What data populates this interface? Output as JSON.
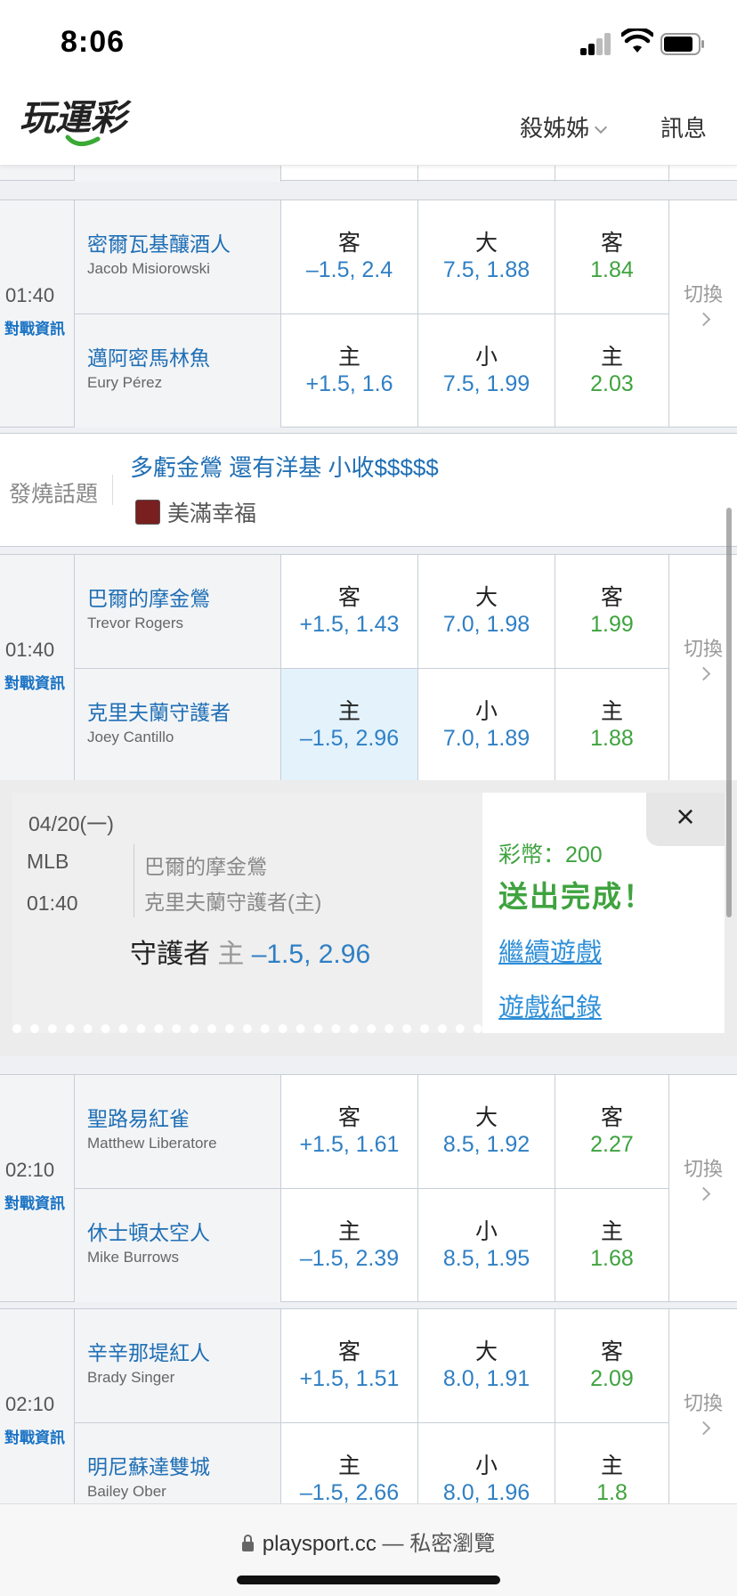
{
  "status": {
    "time": "8:06"
  },
  "header": {
    "logo_text": "玩運彩",
    "user": "殺姊姊",
    "messages": "訊息"
  },
  "common": {
    "info_link": "對戰資訊",
    "switch_label": "切換"
  },
  "games": [
    {
      "time": "01:40",
      "away": {
        "zh": "密爾瓦基釀酒人",
        "en": "Jacob Misiorowski",
        "spread_label": "客",
        "spread": "–1.5, 2.4",
        "total_label": "大",
        "total": "7.5, 1.88",
        "ml_label": "客",
        "ml": "1.84"
      },
      "home": {
        "zh": "邁阿密馬林魚",
        "en": "Eury Pérez",
        "spread_label": "主",
        "spread": "+1.5, 1.6",
        "total_label": "小",
        "total": "7.5, 1.99",
        "ml_label": "主",
        "ml": "2.03"
      }
    },
    {
      "time": "01:40",
      "away": {
        "zh": "巴爾的摩金鶯",
        "en": "Trevor Rogers",
        "spread_label": "客",
        "spread": "+1.5, 1.43",
        "total_label": "大",
        "total": "7.0, 1.98",
        "ml_label": "客",
        "ml": "1.99"
      },
      "home": {
        "zh": "克里夫蘭守護者",
        "en": "Joey Cantillo",
        "spread_label": "主",
        "spread": "–1.5, 2.96",
        "total_label": "小",
        "total": "7.0, 1.89",
        "ml_label": "主",
        "ml": "1.88"
      }
    },
    {
      "time": "02:10",
      "away": {
        "zh": "聖路易紅雀",
        "en": "Matthew Liberatore",
        "spread_label": "客",
        "spread": "+1.5, 1.61",
        "total_label": "大",
        "total": "8.5, 1.92",
        "ml_label": "客",
        "ml": "2.27"
      },
      "home": {
        "zh": "休士頓太空人",
        "en": "Mike Burrows",
        "spread_label": "主",
        "spread": "–1.5, 2.39",
        "total_label": "小",
        "total": "8.5, 1.95",
        "ml_label": "主",
        "ml": "1.68"
      }
    },
    {
      "time": "02:10",
      "away": {
        "zh": "辛辛那堤紅人",
        "en": "Brady Singer",
        "spread_label": "客",
        "spread": "+1.5, 1.51",
        "total_label": "大",
        "total": "8.0, 1.91",
        "ml_label": "客",
        "ml": "2.09"
      },
      "home": {
        "zh": "明尼蘇達雙城",
        "en": "Bailey Ober",
        "spread_label": "主",
        "spread": "–1.5, 2.66",
        "total_label": "小",
        "total": "8.0, 1.96",
        "ml_label": "主",
        "ml": "1.8"
      }
    }
  ],
  "topic": {
    "label": "發燒話題",
    "title": "多虧金鶯 還有洋基 小收$$$$$",
    "user": "美滿幸福"
  },
  "confirm": {
    "date": "04/20(一)",
    "league": "MLB",
    "time": "01:40",
    "team_away": "巴爾的摩金鶯",
    "team_home": "克里夫蘭守護者(主)",
    "bet_team": "守護者",
    "bet_side": "主",
    "bet_value": "–1.5, 2.96",
    "coins": "彩幣：200",
    "status": "送出完成！",
    "continue": "繼續遊戲",
    "record": "遊戲紀錄",
    "close": "×"
  },
  "browser": {
    "url": "playsport.cc",
    "mode": " — 私密瀏覽"
  },
  "colors": {
    "team_blue": "#1f6fb5",
    "odds_blue": "#2f7fc4",
    "odds_green": "#3fa33f",
    "highlight": "#e3f2fb"
  }
}
